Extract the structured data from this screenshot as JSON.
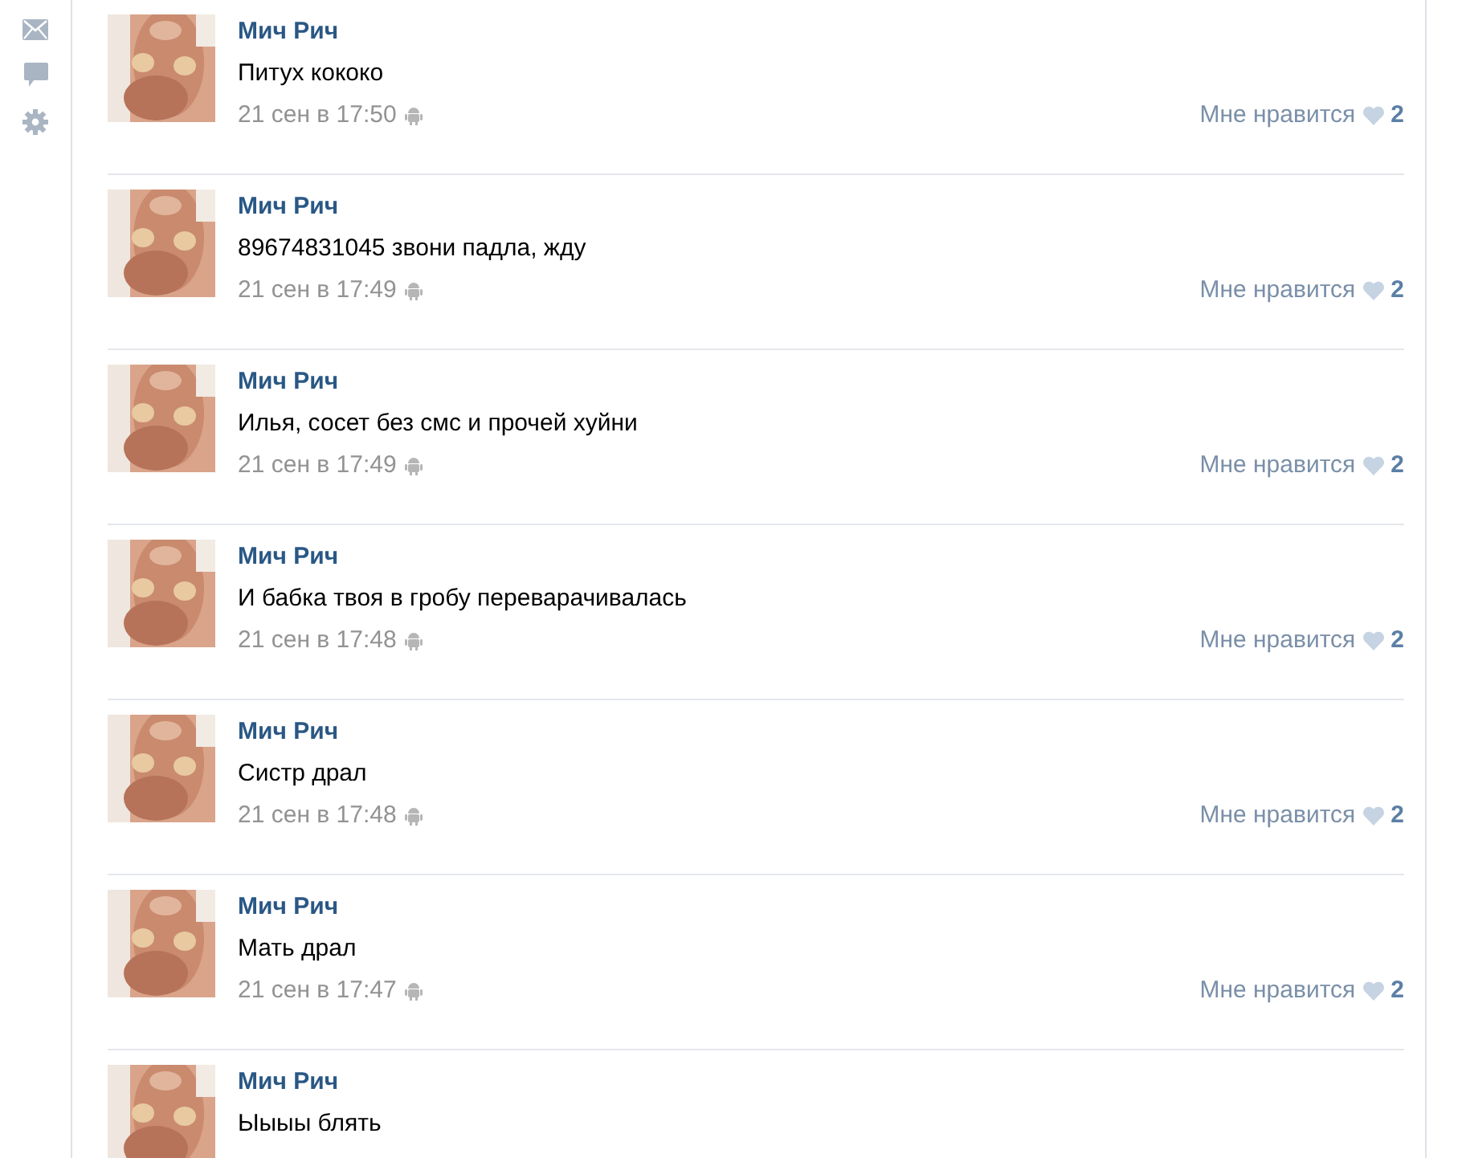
{
  "sidebar": {
    "items": [
      {
        "kind": "mail"
      },
      {
        "kind": "chat"
      },
      {
        "kind": "settings"
      }
    ]
  },
  "comments": [
    {
      "author": "Мич Рич",
      "text": "Питух кококо",
      "time": "21 сен в 17:50",
      "like_label": "Мне нравится",
      "likes": "2"
    },
    {
      "author": "Мич Рич",
      "text": "89674831045 звони падла, жду",
      "time": "21 сен в 17:49",
      "like_label": "Мне нравится",
      "likes": "2"
    },
    {
      "author": "Мич Рич",
      "text": "Илья, сосет без смс и прочей хуйни",
      "time": "21 сен в 17:49",
      "like_label": "Мне нравится",
      "likes": "2"
    },
    {
      "author": "Мич Рич",
      "text": "И бабка твоя в гробу переварачивалась",
      "time": "21 сен в 17:48",
      "like_label": "Мне нравится",
      "likes": "2"
    },
    {
      "author": "Мич Рич",
      "text": "Систр драл",
      "time": "21 сен в 17:48",
      "like_label": "Мне нравится",
      "likes": "2"
    },
    {
      "author": "Мич Рич",
      "text": "Мать драл",
      "time": "21 сен в 17:47",
      "like_label": "Мне нравится",
      "likes": "2"
    },
    {
      "author": "Мич Рич",
      "text": "Ыыыы блять"
    }
  ]
}
